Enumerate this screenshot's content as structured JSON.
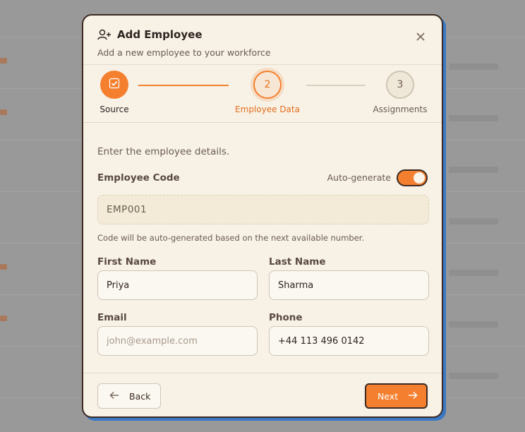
{
  "dialog": {
    "title": "Add Employee",
    "subtitle": "Add a new employee to your workforce"
  },
  "stepper": {
    "steps": [
      {
        "label": "Source",
        "number": "",
        "status": "completed"
      },
      {
        "label": "Employee Data",
        "number": "2",
        "status": "active"
      },
      {
        "label": "Assignments",
        "number": "3",
        "status": "pending"
      }
    ]
  },
  "form": {
    "intro": "Enter the employee details.",
    "employee_code": {
      "label": "Employee Code",
      "auto_generate_label": "Auto-generate",
      "auto_generate_on": true,
      "value": "EMP001",
      "hint": "Code will be auto-generated based on the next available number."
    },
    "first_name": {
      "label": "First Name",
      "value": "Priya"
    },
    "last_name": {
      "label": "Last Name",
      "value": "Sharma"
    },
    "email": {
      "label": "Email",
      "value": "",
      "placeholder": "john@example.com"
    },
    "phone": {
      "label": "Phone",
      "value": "+44 113 496 0142"
    }
  },
  "footer": {
    "back_label": "Back",
    "next_label": "Next"
  },
  "colors": {
    "accent": "#f4802f",
    "modal_bg": "#f7f1e6",
    "border_dark": "#3b2a22",
    "shadow_blue": "#3a78c4"
  },
  "icons": {
    "title": "add-user-icon",
    "close": "close-icon",
    "step_done": "check-icon",
    "back": "arrow-left-icon",
    "next": "arrow-right-icon"
  }
}
